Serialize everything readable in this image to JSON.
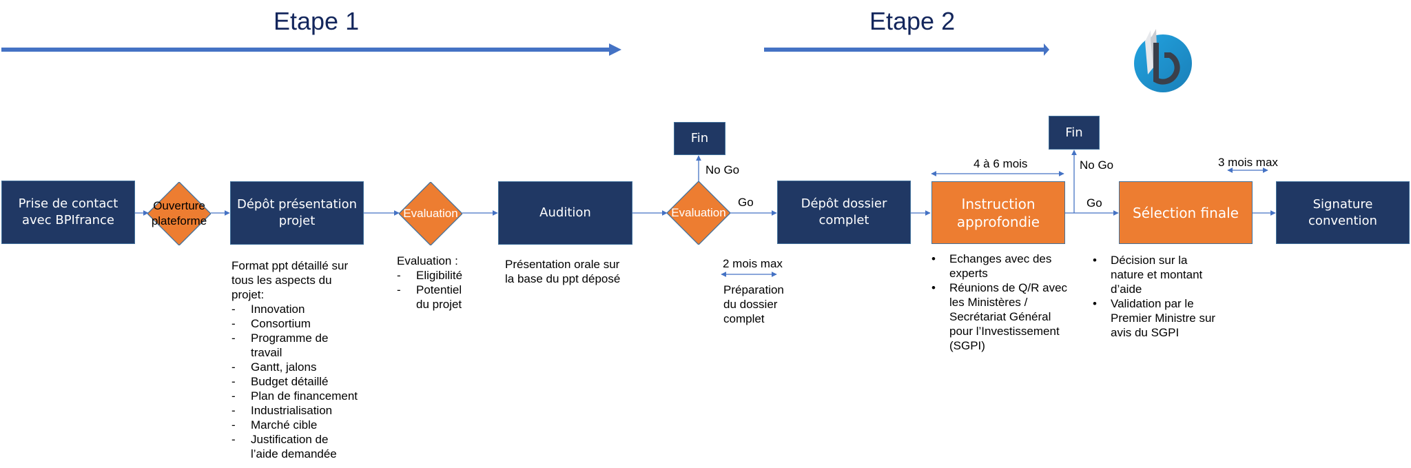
{
  "stages": [
    {
      "title": "Etape 1"
    },
    {
      "title": "Etape 2"
    }
  ],
  "colors": {
    "navy": "#203864",
    "orange": "#ed7d31",
    "arrow_blue": "#4472c4",
    "title_blue": "#13265c",
    "logo_blue": "#1f9ad6",
    "logo_dark": "#3a3f4a"
  },
  "logo": {
    "icon": "b-letter-logo-icon"
  },
  "nodes": {
    "prise_contact": "Prise de contact avec BPIfrance",
    "ouverture": "Ouverture plateforme",
    "depot_presentation": "Dépôt présentation projet",
    "evaluation1": "Evaluation",
    "audition": "Audition",
    "evaluation2": "Evaluation",
    "fin1": "Fin",
    "depot_dossier": "Dépôt dossier complet",
    "instruction": "Instruction approfondie",
    "fin2": "Fin",
    "selection": "Sélection finale",
    "signature": "Signature convention"
  },
  "edge_labels": {
    "nogo1": "No Go",
    "go1": "Go",
    "nogo2": "No Go",
    "go2": "Go"
  },
  "durations": {
    "d1": "2 mois max",
    "d2": "4 à 6 mois",
    "d3": "3 mois max"
  },
  "notes": {
    "depot_presentation": {
      "intro": [
        "Format ppt détaillé sur",
        "tous les aspects du",
        "projet:"
      ],
      "bullet": "-",
      "items": [
        "Innovation",
        "Consortium",
        "Programme de travail",
        "Gantt, jalons",
        "Budget détaillé",
        "Plan de financement",
        "Industrialisation",
        "Marché cible",
        "Justification de l’aide demandée"
      ]
    },
    "evaluation1": {
      "intro": [
        "Evaluation :"
      ],
      "bullet": "-",
      "items": [
        "Eligibilité",
        "Potentiel du projet"
      ]
    },
    "audition": {
      "lines": [
        "Présentation orale sur",
        "la base du ppt déposé"
      ]
    },
    "depot_dossier": {
      "lines": [
        "Préparation",
        "du dossier",
        "complet"
      ]
    },
    "instruction": {
      "bullet": "•",
      "items": [
        "Echanges avec des experts",
        "Réunions de Q/R avec les Ministères / Secrétariat Général pour l’Investissement (SGPI)"
      ]
    },
    "selection": {
      "bullet": "•",
      "items": [
        "Décision sur la nature et montant d’aide",
        "Validation par le Premier Ministre sur avis du SGPI"
      ]
    }
  }
}
